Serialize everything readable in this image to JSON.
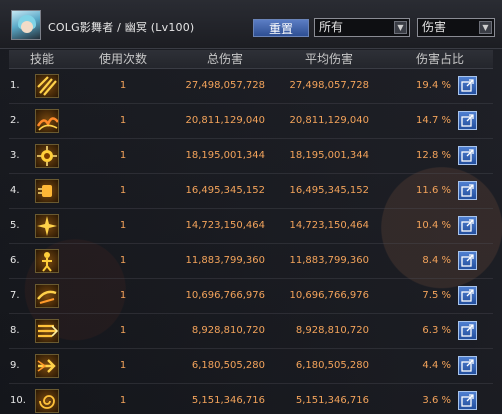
{
  "header": {
    "character_name": "COLG影舞者 / 幽冥 (Lv100)",
    "reset_label": "重置",
    "source_filter": {
      "selected": "所有"
    },
    "type_filter": {
      "selected": "伤害"
    }
  },
  "table": {
    "columns": {
      "skill": "技能",
      "count": "使用次数",
      "total": "总伤害",
      "avg": "平均伤害",
      "pct": "伤害占比"
    },
    "rows": [
      {
        "rank": "1.",
        "icon": "claw-slash-icon",
        "count": "1",
        "total": "27,498,057,728",
        "avg": "27,498,057,728",
        "pct": "19.4 %"
      },
      {
        "rank": "2.",
        "icon": "flame-wave-icon",
        "count": "1",
        "total": "20,811,129,040",
        "avg": "20,811,129,040",
        "pct": "14.7 %"
      },
      {
        "rank": "3.",
        "icon": "orb-burst-icon",
        "count": "1",
        "total": "18,195,001,344",
        "avg": "18,195,001,344",
        "pct": "12.8 %"
      },
      {
        "rank": "4.",
        "icon": "fist-strike-icon",
        "count": "1",
        "total": "16,495,345,152",
        "avg": "16,495,345,152",
        "pct": "11.6 %"
      },
      {
        "rank": "5.",
        "icon": "star-burst-icon",
        "count": "1",
        "total": "14,723,150,464",
        "avg": "14,723,150,464",
        "pct": "10.4 %"
      },
      {
        "rank": "6.",
        "icon": "figure-pose-icon",
        "count": "1",
        "total": "11,883,799,360",
        "avg": "11,883,799,360",
        "pct": "8.4 %"
      },
      {
        "rank": "7.",
        "icon": "dash-kick-icon",
        "count": "1",
        "total": "10,696,766,976",
        "avg": "10,696,766,976",
        "pct": "7.5 %"
      },
      {
        "rank": "8.",
        "icon": "blade-rush-icon",
        "count": "1",
        "total": "8,928,810,720",
        "avg": "8,928,810,720",
        "pct": "6.3 %"
      },
      {
        "rank": "9.",
        "icon": "arrow-strike-icon",
        "count": "1",
        "total": "6,180,505,280",
        "avg": "6,180,505,280",
        "pct": "4.4 %"
      },
      {
        "rank": "10.",
        "icon": "spiral-slash-icon",
        "count": "1",
        "total": "5,151,346,716",
        "avg": "5,151,346,716",
        "pct": "3.6 %"
      }
    ]
  },
  "colors": {
    "value_text": "#f3a35b",
    "header_text": "#c8c8c8",
    "accent_blue": "#2e4f93"
  }
}
